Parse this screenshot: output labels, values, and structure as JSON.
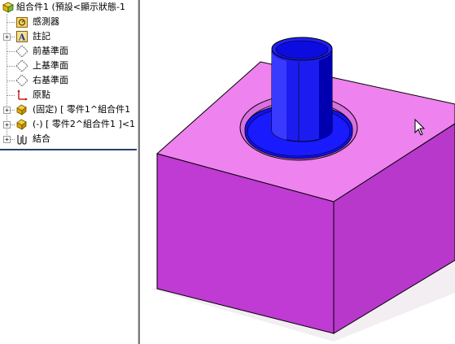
{
  "feature_tree": {
    "root": {
      "label": "組合件1 (預設<顯示狀態-1",
      "icon": "assembly-icon"
    },
    "items": [
      {
        "label": "感測器",
        "icon": "sensor-icon",
        "expandable": false
      },
      {
        "label": "註記",
        "icon": "annotation-icon",
        "expandable": true,
        "expander": "+"
      },
      {
        "label": "前基準面",
        "icon": "plane-icon",
        "expandable": false
      },
      {
        "label": "上基準面",
        "icon": "plane-icon",
        "expandable": false
      },
      {
        "label": "右基準面",
        "icon": "plane-icon",
        "expandable": false
      },
      {
        "label": "原點",
        "icon": "origin-icon",
        "expandable": false
      },
      {
        "label": "(固定) [ 零件1^組合件1",
        "icon": "part-icon",
        "expandable": true,
        "expander": "+"
      },
      {
        "label": "(-) [ 零件2^組合件1 ]<1",
        "icon": "part-icon",
        "expandable": true,
        "expander": "+"
      },
      {
        "label": "結合",
        "icon": "mates-icon",
        "expandable": true,
        "expander": "+"
      }
    ]
  },
  "model": {
    "block_top_color": "#ee82ee",
    "block_front_color": "#c040d0",
    "block_right_color": "#a42eb8",
    "cylinder_color": "#1010f0",
    "cylinder_dark_color": "#0000a8",
    "edge_color": "#000000"
  },
  "colors": {
    "panel_separator": "#2b3e6e"
  }
}
